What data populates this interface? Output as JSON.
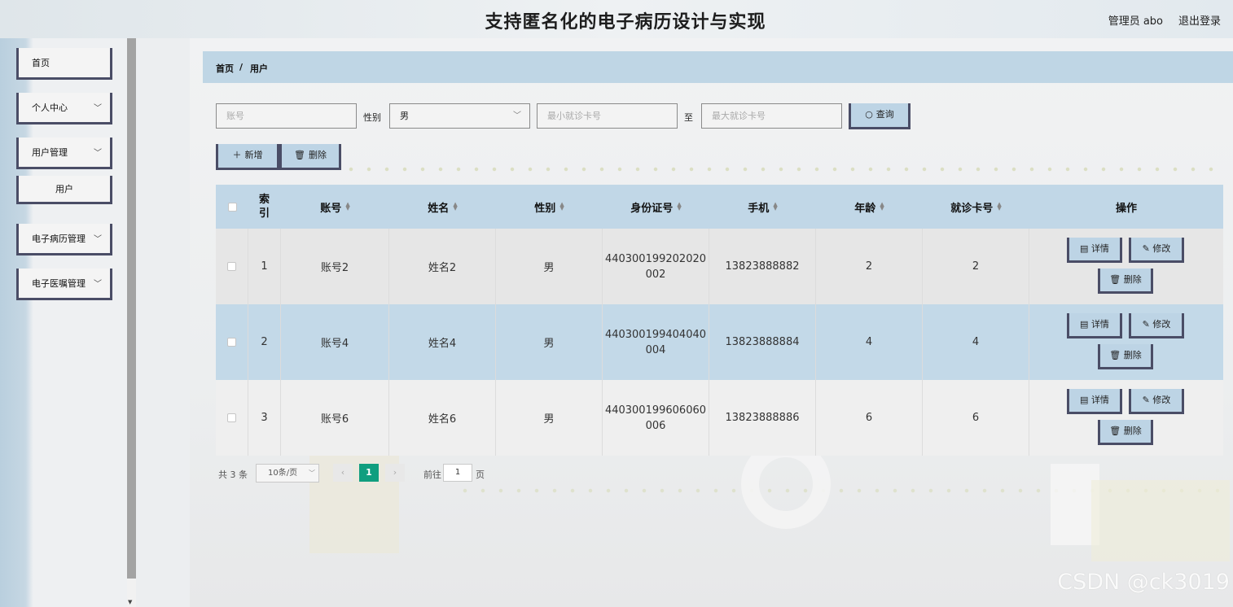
{
  "header": {
    "title": "支持匿名化的电子病历设计与实现",
    "user": "管理员 abo",
    "logout": "退出登录"
  },
  "sidebar": {
    "items": [
      {
        "label": "首页"
      },
      {
        "label": "个人中心"
      },
      {
        "label": "用户管理"
      },
      {
        "label": "用户"
      },
      {
        "label": "电子病历管理"
      },
      {
        "label": "电子医嘱管理"
      }
    ]
  },
  "breadcrumb": {
    "home": "首页",
    "sep": "/",
    "current": "用户"
  },
  "search": {
    "account_placeholder": "账号",
    "gender_label": "性别",
    "gender_value": "男",
    "min_card_placeholder": "最小就诊卡号",
    "to_label": "至",
    "max_card_placeholder": "最大就诊卡号",
    "query_button": "查询"
  },
  "toolbar": {
    "add_button": "新增",
    "delete_button": "删除"
  },
  "table": {
    "headers": [
      "索引",
      "账号",
      "姓名",
      "性别",
      "身份证号",
      "手机",
      "年龄",
      "就诊卡号",
      "操作"
    ],
    "rows": [
      {
        "index": "1",
        "account": "账号2",
        "name": "姓名2",
        "gender": "男",
        "id_line1": "440300199202020",
        "id_line2": "002",
        "phone": "13823888882",
        "age": "2",
        "card": "2"
      },
      {
        "index": "2",
        "account": "账号4",
        "name": "姓名4",
        "gender": "男",
        "id_line1": "440300199404040",
        "id_line2": "004",
        "phone": "13823888884",
        "age": "4",
        "card": "4"
      },
      {
        "index": "3",
        "account": "账号6",
        "name": "姓名6",
        "gender": "男",
        "id_line1": "440300199606060",
        "id_line2": "006",
        "phone": "13823888886",
        "age": "6",
        "card": "6"
      }
    ],
    "actions": {
      "detail": "详情",
      "edit": "修改",
      "delete": "删除"
    }
  },
  "pagination": {
    "total": "共 3 条",
    "page_size": "10条/页",
    "current_page": "1",
    "goto_label": "前往",
    "goto_value": "1",
    "page_suffix": "页"
  },
  "watermark": "CSDN @ck3019",
  "colors": {
    "header_bg": "#bfd6e5",
    "button_bg": "#bdd4e5",
    "button_border": "#4a4d66",
    "pagination_active": "#109e7f"
  }
}
